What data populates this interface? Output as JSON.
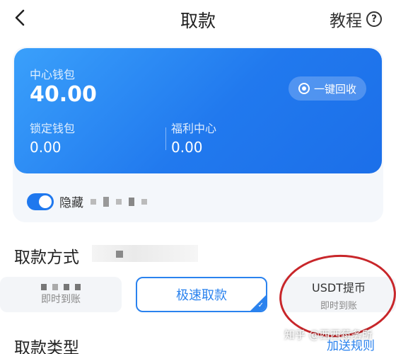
{
  "nav": {
    "title": "取款",
    "tutorial_label": "教程",
    "help_symbol": "?"
  },
  "wallet": {
    "center_label": "中心钱包",
    "center_amount": "40.00",
    "locked_label": "锁定钱包",
    "locked_amount": "0.00",
    "welfare_label": "福利中心",
    "welfare_amount": "0.00",
    "recycle_label": "一键回收"
  },
  "toggle": {
    "label": "隐藏",
    "on": true
  },
  "sections": {
    "method_title": "取款方式",
    "type_title": "取款类型",
    "rule_link": "加送规则"
  },
  "methods": [
    {
      "title": "",
      "subtitle": "即时到账",
      "selected": false
    },
    {
      "title": "极速取款",
      "subtitle": "",
      "selected": true
    },
    {
      "title": "USDT提币",
      "subtitle": "即时到账",
      "selected": false
    }
  ],
  "watermark": "知乎 @西西莓务所",
  "colors": {
    "accent": "#2a82ee",
    "card_gradient_start": "#3aa0fb",
    "card_gradient_end": "#1c6fe9",
    "annotation_red": "#c8262a"
  }
}
